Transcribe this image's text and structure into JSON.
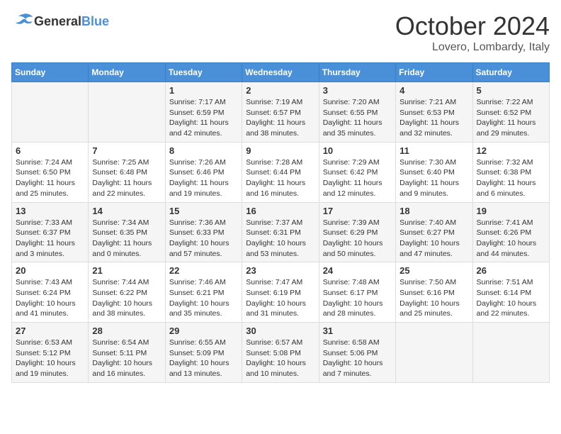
{
  "logo": {
    "general": "General",
    "blue": "Blue"
  },
  "title": "October 2024",
  "location": "Lovero, Lombardy, Italy",
  "days_of_week": [
    "Sunday",
    "Monday",
    "Tuesday",
    "Wednesday",
    "Thursday",
    "Friday",
    "Saturday"
  ],
  "weeks": [
    [
      {
        "day": "",
        "content": ""
      },
      {
        "day": "",
        "content": ""
      },
      {
        "day": "1",
        "sunrise": "Sunrise: 7:17 AM",
        "sunset": "Sunset: 6:59 PM",
        "daylight": "Daylight: 11 hours and 42 minutes."
      },
      {
        "day": "2",
        "sunrise": "Sunrise: 7:19 AM",
        "sunset": "Sunset: 6:57 PM",
        "daylight": "Daylight: 11 hours and 38 minutes."
      },
      {
        "day": "3",
        "sunrise": "Sunrise: 7:20 AM",
        "sunset": "Sunset: 6:55 PM",
        "daylight": "Daylight: 11 hours and 35 minutes."
      },
      {
        "day": "4",
        "sunrise": "Sunrise: 7:21 AM",
        "sunset": "Sunset: 6:53 PM",
        "daylight": "Daylight: 11 hours and 32 minutes."
      },
      {
        "day": "5",
        "sunrise": "Sunrise: 7:22 AM",
        "sunset": "Sunset: 6:52 PM",
        "daylight": "Daylight: 11 hours and 29 minutes."
      }
    ],
    [
      {
        "day": "6",
        "sunrise": "Sunrise: 7:24 AM",
        "sunset": "Sunset: 6:50 PM",
        "daylight": "Daylight: 11 hours and 25 minutes."
      },
      {
        "day": "7",
        "sunrise": "Sunrise: 7:25 AM",
        "sunset": "Sunset: 6:48 PM",
        "daylight": "Daylight: 11 hours and 22 minutes."
      },
      {
        "day": "8",
        "sunrise": "Sunrise: 7:26 AM",
        "sunset": "Sunset: 6:46 PM",
        "daylight": "Daylight: 11 hours and 19 minutes."
      },
      {
        "day": "9",
        "sunrise": "Sunrise: 7:28 AM",
        "sunset": "Sunset: 6:44 PM",
        "daylight": "Daylight: 11 hours and 16 minutes."
      },
      {
        "day": "10",
        "sunrise": "Sunrise: 7:29 AM",
        "sunset": "Sunset: 6:42 PM",
        "daylight": "Daylight: 11 hours and 12 minutes."
      },
      {
        "day": "11",
        "sunrise": "Sunrise: 7:30 AM",
        "sunset": "Sunset: 6:40 PM",
        "daylight": "Daylight: 11 hours and 9 minutes."
      },
      {
        "day": "12",
        "sunrise": "Sunrise: 7:32 AM",
        "sunset": "Sunset: 6:38 PM",
        "daylight": "Daylight: 11 hours and 6 minutes."
      }
    ],
    [
      {
        "day": "13",
        "sunrise": "Sunrise: 7:33 AM",
        "sunset": "Sunset: 6:37 PM",
        "daylight": "Daylight: 11 hours and 3 minutes."
      },
      {
        "day": "14",
        "sunrise": "Sunrise: 7:34 AM",
        "sunset": "Sunset: 6:35 PM",
        "daylight": "Daylight: 11 hours and 0 minutes."
      },
      {
        "day": "15",
        "sunrise": "Sunrise: 7:36 AM",
        "sunset": "Sunset: 6:33 PM",
        "daylight": "Daylight: 10 hours and 57 minutes."
      },
      {
        "day": "16",
        "sunrise": "Sunrise: 7:37 AM",
        "sunset": "Sunset: 6:31 PM",
        "daylight": "Daylight: 10 hours and 53 minutes."
      },
      {
        "day": "17",
        "sunrise": "Sunrise: 7:39 AM",
        "sunset": "Sunset: 6:29 PM",
        "daylight": "Daylight: 10 hours and 50 minutes."
      },
      {
        "day": "18",
        "sunrise": "Sunrise: 7:40 AM",
        "sunset": "Sunset: 6:27 PM",
        "daylight": "Daylight: 10 hours and 47 minutes."
      },
      {
        "day": "19",
        "sunrise": "Sunrise: 7:41 AM",
        "sunset": "Sunset: 6:26 PM",
        "daylight": "Daylight: 10 hours and 44 minutes."
      }
    ],
    [
      {
        "day": "20",
        "sunrise": "Sunrise: 7:43 AM",
        "sunset": "Sunset: 6:24 PM",
        "daylight": "Daylight: 10 hours and 41 minutes."
      },
      {
        "day": "21",
        "sunrise": "Sunrise: 7:44 AM",
        "sunset": "Sunset: 6:22 PM",
        "daylight": "Daylight: 10 hours and 38 minutes."
      },
      {
        "day": "22",
        "sunrise": "Sunrise: 7:46 AM",
        "sunset": "Sunset: 6:21 PM",
        "daylight": "Daylight: 10 hours and 35 minutes."
      },
      {
        "day": "23",
        "sunrise": "Sunrise: 7:47 AM",
        "sunset": "Sunset: 6:19 PM",
        "daylight": "Daylight: 10 hours and 31 minutes."
      },
      {
        "day": "24",
        "sunrise": "Sunrise: 7:48 AM",
        "sunset": "Sunset: 6:17 PM",
        "daylight": "Daylight: 10 hours and 28 minutes."
      },
      {
        "day": "25",
        "sunrise": "Sunrise: 7:50 AM",
        "sunset": "Sunset: 6:16 PM",
        "daylight": "Daylight: 10 hours and 25 minutes."
      },
      {
        "day": "26",
        "sunrise": "Sunrise: 7:51 AM",
        "sunset": "Sunset: 6:14 PM",
        "daylight": "Daylight: 10 hours and 22 minutes."
      }
    ],
    [
      {
        "day": "27",
        "sunrise": "Sunrise: 6:53 AM",
        "sunset": "Sunset: 5:12 PM",
        "daylight": "Daylight: 10 hours and 19 minutes."
      },
      {
        "day": "28",
        "sunrise": "Sunrise: 6:54 AM",
        "sunset": "Sunset: 5:11 PM",
        "daylight": "Daylight: 10 hours and 16 minutes."
      },
      {
        "day": "29",
        "sunrise": "Sunrise: 6:55 AM",
        "sunset": "Sunset: 5:09 PM",
        "daylight": "Daylight: 10 hours and 13 minutes."
      },
      {
        "day": "30",
        "sunrise": "Sunrise: 6:57 AM",
        "sunset": "Sunset: 5:08 PM",
        "daylight": "Daylight: 10 hours and 10 minutes."
      },
      {
        "day": "31",
        "sunrise": "Sunrise: 6:58 AM",
        "sunset": "Sunset: 5:06 PM",
        "daylight": "Daylight: 10 hours and 7 minutes."
      },
      {
        "day": "",
        "content": ""
      },
      {
        "day": "",
        "content": ""
      }
    ]
  ]
}
